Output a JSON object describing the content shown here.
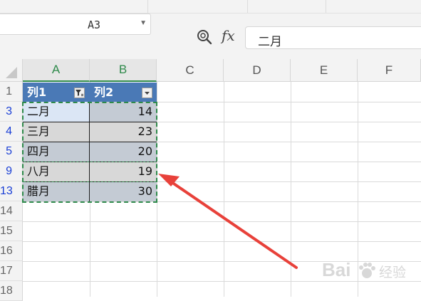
{
  "name_box": {
    "value": "A3"
  },
  "formula_bar": {
    "fx_label": "fx",
    "content": "二月"
  },
  "columns": [
    "A",
    "B",
    "C",
    "D",
    "E",
    "F"
  ],
  "table": {
    "headers": [
      "列1",
      "列2"
    ],
    "rows": [
      {
        "row_number": "3",
        "col1": "二月",
        "col2": "14"
      },
      {
        "row_number": "4",
        "col1": "三月",
        "col2": "23"
      },
      {
        "row_number": "5",
        "col1": "四月",
        "col2": "20"
      },
      {
        "row_number": "9",
        "col1": "八月",
        "col2": "19"
      },
      {
        "row_number": "13",
        "col1": "腊月",
        "col2": "30"
      }
    ]
  },
  "row_numbers_header": "1",
  "row_numbers_after": [
    "14",
    "15",
    "16",
    "17",
    "18"
  ],
  "watermark": {
    "text": "Bai",
    "sub": "经验"
  },
  "colors": {
    "header_fill": "#4a79b6",
    "band_dark": "#c4cbd4",
    "band_light": "#d8d8d8",
    "selected_cell": "#dbe6f5",
    "selection_border": "#2f8a4b",
    "arrow": "#e8413a",
    "row_number_filtered": "#1a3fd6"
  },
  "icons": [
    "zoom-formula-icon",
    "filter-active-icon",
    "dropdown-arrow-icon",
    "select-all-triangle-icon"
  ]
}
